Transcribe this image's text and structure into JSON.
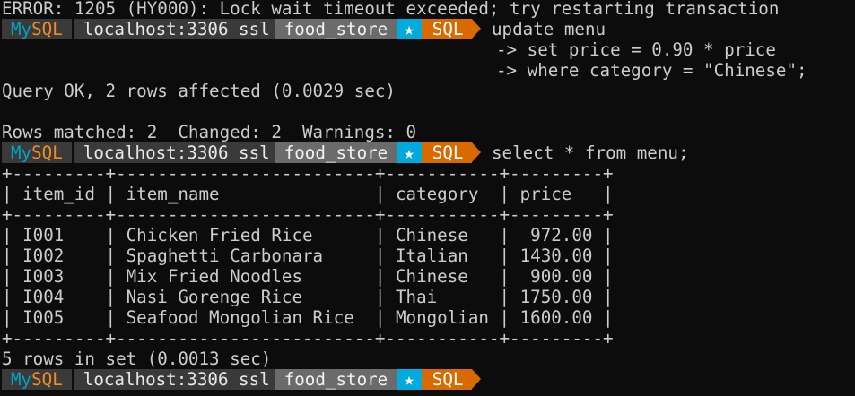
{
  "error_line": "ERROR: 1205 (HY000): Lock wait timeout exceeded; try restarting transaction",
  "prompt": {
    "mysql_my": "My",
    "mysql_sql": "SQL",
    "host": "localhost:3306 ssl",
    "database": "food_store",
    "star": "★",
    "mode": "SQL",
    "caret": ">"
  },
  "update_cmd": {
    "line1": " update menu",
    "cont_prefix": "-> ",
    "line2": "set price = 0.90 * price",
    "line3": "where category = \"Chinese\";"
  },
  "query_ok": "Query OK, 2 rows affected (0.0029 sec)",
  "rows_matched": "Rows matched: 2  Changed: 2  Warnings: 0",
  "select_cmd": " select * from menu;",
  "table": {
    "border": "+---------+-------------------------+-----------+---------+",
    "header": "| item_id | item_name               | category  | price   |",
    "rows": [
      "| I001    | Chicken Fried Rice      | Chinese   |  972.00 |",
      "| I002    | Spaghetti Carbonara     | Italian   | 1430.00 |",
      "| I003    | Mix Fried Noodles       | Chinese   |  900.00 |",
      "| I004    | Nasi Gorenge Rice       | Thai      | 1750.00 |",
      "| I005    | Seafood Mongolian Rice  | Mongolian | 1600.00 |"
    ]
  },
  "rows_in_set": "5 rows in set (0.0013 sec)",
  "final_caret": ">"
}
